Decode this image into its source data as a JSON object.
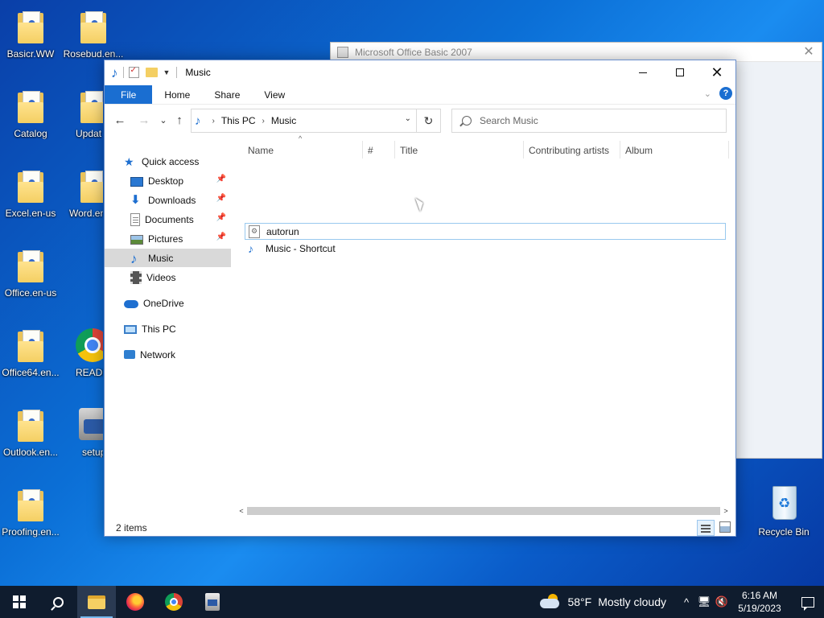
{
  "desktop": {
    "icons": [
      {
        "label": "Basicr.WW"
      },
      {
        "label": "Rosebud.en..."
      },
      {
        "label": "Catalog"
      },
      {
        "label": "Updat"
      },
      {
        "label": "Excel.en-us"
      },
      {
        "label": "Word.en"
      },
      {
        "label": "Office.en-us"
      },
      {
        "label": "Office64.en..."
      },
      {
        "label": "READM"
      },
      {
        "label": "Outlook.en..."
      },
      {
        "label": "setup"
      },
      {
        "label": "Proofing.en..."
      },
      {
        "label": "Recycle Bin"
      }
    ]
  },
  "background_window": {
    "title": "Microsoft Office Basic 2007",
    "close_glyph": "✕"
  },
  "explorer": {
    "title": "Music",
    "window_controls": {
      "close_glyph": "✕"
    },
    "ribbon": {
      "tabs": [
        "File",
        "Home",
        "Share",
        "View"
      ],
      "expand_glyph": "⌄",
      "help_glyph": "?"
    },
    "nav": {
      "back_glyph": "←",
      "forward_glyph": "→",
      "recent_glyph": "⌄",
      "up_glyph": "↑",
      "breadcrumb": [
        "This PC",
        "Music"
      ],
      "crumb_sep": "›",
      "dropdown_glyph": "⌄",
      "refresh_glyph": "↻",
      "search_placeholder": "Search Music"
    },
    "nav_pane": {
      "quick_access": "Quick access",
      "items": [
        {
          "label": "Desktop",
          "pinned": true
        },
        {
          "label": "Downloads",
          "pinned": true
        },
        {
          "label": "Documents",
          "pinned": true
        },
        {
          "label": "Pictures",
          "pinned": true
        },
        {
          "label": "Music",
          "selected": true
        },
        {
          "label": "Videos"
        }
      ],
      "onedrive": "OneDrive",
      "this_pc": "This PC",
      "network": "Network",
      "pin_glyph": "📌"
    },
    "columns": [
      "Name",
      "#",
      "Title",
      "Contributing artists",
      "Album"
    ],
    "sort_glyph": "^",
    "files": [
      {
        "name": "autorun",
        "icon": "config-file-icon",
        "focused": true
      },
      {
        "name": "Music - Shortcut",
        "icon": "music-shortcut-icon"
      }
    ],
    "scroll": {
      "left_glyph": "<",
      "right_glyph": ">"
    },
    "status": {
      "item_count": "2 items"
    }
  },
  "taskbar": {
    "weather": {
      "temp": "58°F",
      "desc": "Mostly cloudy"
    },
    "tray": {
      "chevron": "^",
      "network_glyph": "🖥",
      "volume_glyph": "🔇"
    },
    "clock": {
      "time": "6:16 AM",
      "date": "5/19/2023"
    }
  },
  "colors": {
    "accent": "#1a6ed1",
    "selected_nav": "#d9d9d9",
    "taskbar": "#0f1c2e"
  }
}
